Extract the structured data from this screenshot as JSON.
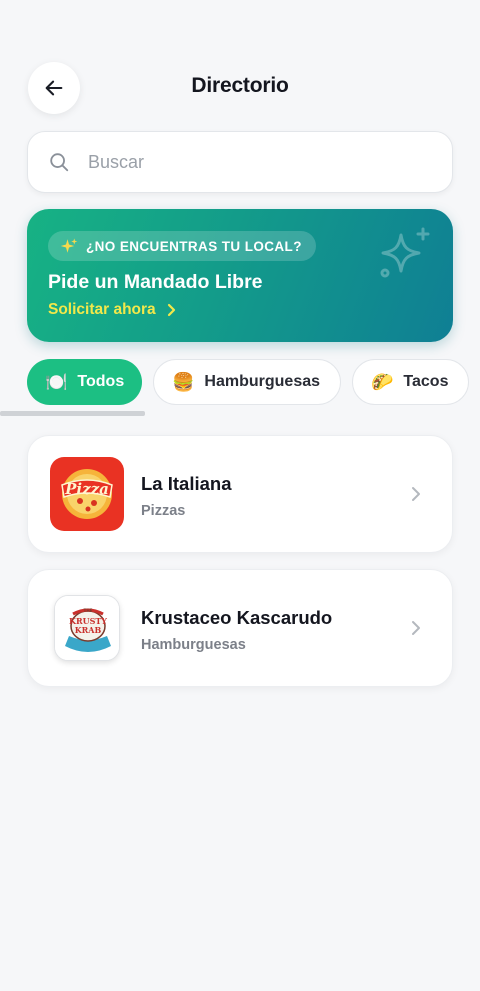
{
  "header": {
    "title": "Directorio"
  },
  "search": {
    "placeholder": "Buscar"
  },
  "promo": {
    "badge": "¿NO ENCUENTRAS TU LOCAL?",
    "title": "Pide un Mandado Libre",
    "link": "Solicitar ahora"
  },
  "chips": [
    {
      "emoji": "🍽️",
      "label": "Todos",
      "active": true
    },
    {
      "emoji": "🍔",
      "label": "Hamburguesas",
      "active": false
    },
    {
      "emoji": "🌮",
      "label": "Tacos",
      "active": false
    }
  ],
  "stores": [
    {
      "name": "La Italiana",
      "category": "Pizzas",
      "logo_text": "Pizza",
      "logo_icon": "pizza-logo"
    },
    {
      "name": "Krustaceo Kascarudo",
      "category": "Hamburguesas",
      "logo_text": "THE KRUSTY KRAB",
      "logo_icon": "krusty-krab-logo"
    }
  ],
  "colors": {
    "accent": "#1cbf83",
    "promo_gradient_start": "#17b284",
    "promo_gradient_end": "#0f7f94",
    "promo_link": "#f2e84a"
  }
}
